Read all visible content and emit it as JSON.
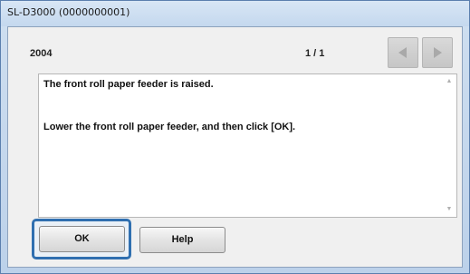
{
  "window": {
    "title": "SL-D3000 (0000000001)"
  },
  "header": {
    "code": "2004",
    "page": "1 / 1"
  },
  "message": {
    "line1": "The front roll paper feeder is raised.",
    "line2": "Lower the front roll paper feeder, and then click [OK]."
  },
  "buttons": {
    "ok": "OK",
    "help": "Help"
  },
  "icons": {
    "prev": "triangle-left-icon",
    "next": "triangle-right-icon",
    "scroll_up": "scroll-up-arrow-icon",
    "scroll_down": "scroll-down-arrow-icon"
  },
  "colors": {
    "focus_ring": "#2f6fb0"
  }
}
